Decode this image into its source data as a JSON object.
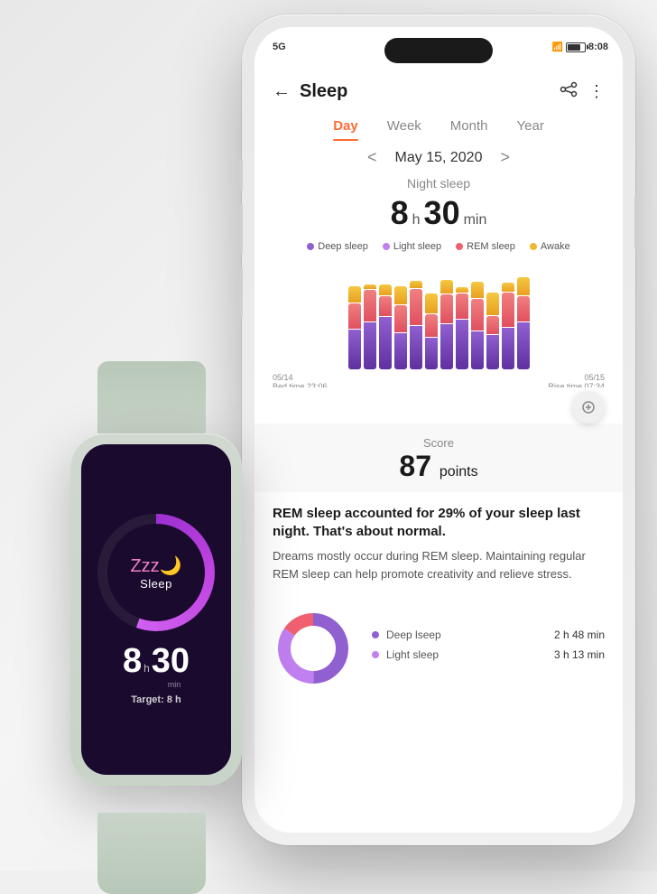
{
  "background": "#f0f0f0",
  "phone": {
    "status": {
      "left": "5G",
      "signal": "|||",
      "time": "8:08"
    },
    "header": {
      "back_label": "←",
      "title": "Sleep",
      "share_icon": "share",
      "more_icon": "⋮"
    },
    "tabs": [
      {
        "label": "Day",
        "active": true
      },
      {
        "label": "Week",
        "active": false
      },
      {
        "label": "Month",
        "active": false
      },
      {
        "label": "Year",
        "active": false
      }
    ],
    "date_nav": {
      "prev": "<",
      "date": "May 15, 2020",
      "next": ">"
    },
    "sleep_summary": {
      "label": "Night sleep",
      "hours": "8",
      "h_unit": "h",
      "minutes": "30",
      "min_unit": "min"
    },
    "legend": [
      {
        "label": "Deep sleep",
        "color": "#9060d0"
      },
      {
        "label": "Light sleep",
        "color": "#c080f0"
      },
      {
        "label": "REM sleep",
        "color": "#f06070"
      },
      {
        "label": "Awake",
        "color": "#f0b830"
      }
    ],
    "chart": {
      "left_label1": "05/14",
      "left_label2": "Bed time 23:06",
      "right_label1": "05/15",
      "right_label2": "Rise time 07:34",
      "bars": [
        {
          "yellow": 18,
          "pink": 28,
          "purple": 44
        },
        {
          "yellow": 5,
          "pink": 35,
          "purple": 52
        },
        {
          "yellow": 12,
          "pink": 22,
          "purple": 58
        },
        {
          "yellow": 20,
          "pink": 30,
          "purple": 40
        },
        {
          "yellow": 8,
          "pink": 40,
          "purple": 48
        },
        {
          "yellow": 22,
          "pink": 25,
          "purple": 35
        },
        {
          "yellow": 15,
          "pink": 32,
          "purple": 50
        },
        {
          "yellow": 6,
          "pink": 28,
          "purple": 55
        },
        {
          "yellow": 18,
          "pink": 35,
          "purple": 42
        },
        {
          "yellow": 25,
          "pink": 20,
          "purple": 38
        },
        {
          "yellow": 10,
          "pink": 38,
          "purple": 46
        },
        {
          "yellow": 20,
          "pink": 28,
          "purple": 52
        }
      ]
    },
    "score": {
      "label": "Score",
      "value": "87",
      "unit": "points"
    },
    "insight": {
      "heading": "REM sleep accounted for 29% of your sleep last night. That's about normal.",
      "body": "Dreams mostly occur during REM sleep. Maintaining regular REM sleep can help promote creativity and relieve stress."
    },
    "breakdown": [
      {
        "label": "Deep lseep",
        "color": "#9060d0",
        "time": "2 h 48 min"
      },
      {
        "label": "Light sleep",
        "color": "#c080f0",
        "time": "3 h 13 min"
      }
    ]
  },
  "watch": {
    "sleep_label": "Sleep",
    "hours": "8",
    "dot": ".",
    "minutes": "30",
    "h_label": "h",
    "min_label": "min",
    "target_label": "Target:",
    "target_value": "8 h",
    "circle_color": "#9b30d0",
    "zzz": "Zzz"
  }
}
